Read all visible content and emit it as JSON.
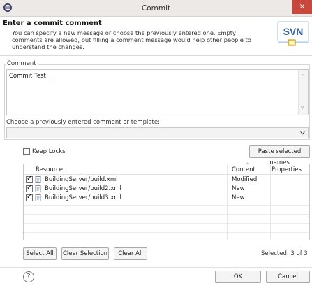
{
  "window": {
    "title": "Commit",
    "close_glyph": "×"
  },
  "header": {
    "title": "Enter a commit comment",
    "description": "You can specify a new message or choose the previously entered one. Empty comments are allowed, but filling a comment message would help other people to understand the changes.",
    "logo_text": "SVN"
  },
  "comment": {
    "legend": "Comment",
    "value": "Commit Test",
    "template_label": "Choose a previously entered comment or template:",
    "template_selected": ""
  },
  "options": {
    "keep_locks_label": "Keep Locks",
    "keep_locks_checked": false,
    "paste_names_label": "Paste selected names"
  },
  "table": {
    "columns": [
      "Resource",
      "Content",
      "Properties"
    ],
    "rows": [
      {
        "checked": true,
        "resource": "BuildingServer/build.xml",
        "content": "Modified",
        "properties": ""
      },
      {
        "checked": true,
        "resource": "BuildingServer/build2.xml",
        "content": "New",
        "properties": ""
      },
      {
        "checked": true,
        "resource": "BuildingServer/build3.xml",
        "content": "New",
        "properties": ""
      }
    ]
  },
  "actions": {
    "select_all": "Select All",
    "clear_selection": "Clear Selection",
    "clear_all": "Clear All",
    "selected_status": "Selected: 3 of 3"
  },
  "footer": {
    "help_glyph": "?",
    "ok": "OK",
    "cancel": "Cancel"
  },
  "icons": {
    "app": "eclipse-icon",
    "file": "xml-file-icon",
    "help": "help-icon"
  }
}
